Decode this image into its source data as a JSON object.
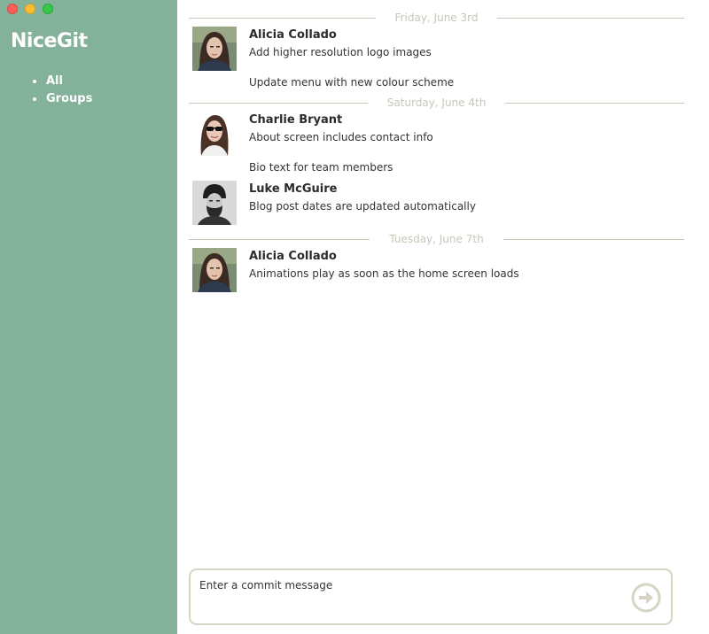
{
  "window": {
    "traffic_lights": [
      "close",
      "minimize",
      "maximize"
    ]
  },
  "sidebar": {
    "app_title": "NiceGit",
    "items": [
      {
        "label": "All"
      },
      {
        "label": "Groups"
      }
    ],
    "background_color": "#84b199"
  },
  "feed": {
    "days": [
      {
        "date": "Friday, June 3rd",
        "groups": [
          {
            "author": "Alicia Collado",
            "avatar_icon": "alicia-avatar",
            "messages": [
              "Add higher resolution logo images",
              "Update menu with new colour scheme"
            ]
          }
        ]
      },
      {
        "date": "Saturday, June 4th",
        "groups": [
          {
            "author": "Charlie Bryant",
            "avatar_icon": "charlie-avatar",
            "messages": [
              "About screen includes contact info",
              "Bio text for team members"
            ]
          },
          {
            "author": "Luke McGuire",
            "avatar_icon": "luke-avatar",
            "messages": [
              "Blog post dates are updated automatically"
            ]
          }
        ]
      },
      {
        "date": "Tuesday, June 7th",
        "groups": [
          {
            "author": "Alicia Collado",
            "avatar_icon": "alicia-avatar",
            "messages": [
              "Animations play as soon as the home screen loads"
            ]
          }
        ]
      }
    ]
  },
  "composer": {
    "placeholder": "Enter a commit message",
    "value": "",
    "send_icon": "arrow-circle-right-icon",
    "accent_color": "#d6d4c2"
  }
}
